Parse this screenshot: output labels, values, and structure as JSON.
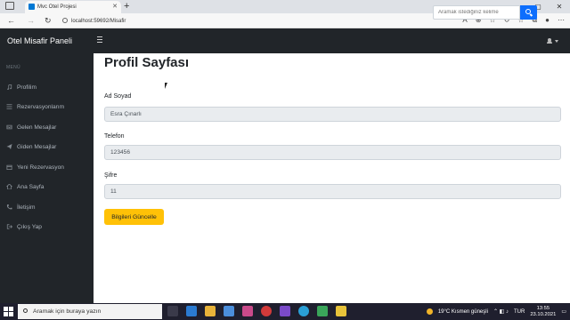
{
  "browser": {
    "tab_title": "Mvc Otel Projesi",
    "url": "localhost:59692/Misafir"
  },
  "navbar": {
    "brand": "Otel Misafir Paneli",
    "search_placeholder": "Aramak istediğiniz kelime"
  },
  "sidebar": {
    "heading": "MENÜ",
    "items": [
      {
        "label": "Profilim",
        "icon": "music-icon"
      },
      {
        "label": "Rezervasyonlarım",
        "icon": "list-icon"
      },
      {
        "label": "Gelen Mesajlar",
        "icon": "inbox-icon"
      },
      {
        "label": "Giden Mesajlar",
        "icon": "send-icon"
      },
      {
        "label": "Yeni Rezervasyon",
        "icon": "calendar-icon"
      },
      {
        "label": "Ana Sayfa",
        "icon": "home-icon"
      },
      {
        "label": "İletişim",
        "icon": "phone-icon"
      },
      {
        "label": "Çıkış Yap",
        "icon": "logout-icon"
      }
    ]
  },
  "main": {
    "title": "Profil Sayfası",
    "fields": [
      {
        "label": "Ad Soyad",
        "value": "Esra Çınarlı"
      },
      {
        "label": "Telefon",
        "value": "123456"
      },
      {
        "label": "Şifre",
        "value": "11"
      }
    ],
    "save_label": "Bilgileri Güncelle"
  },
  "taskbar": {
    "search_placeholder": "Aramak için buraya yazın",
    "weather": "19°C  Kısmen güneşli",
    "language": "TUR",
    "time": "13:55",
    "date": "23.10.2021"
  },
  "colors": {
    "nav_bg": "#212529",
    "primary": "#0d6efd",
    "warning": "#ffc107"
  }
}
